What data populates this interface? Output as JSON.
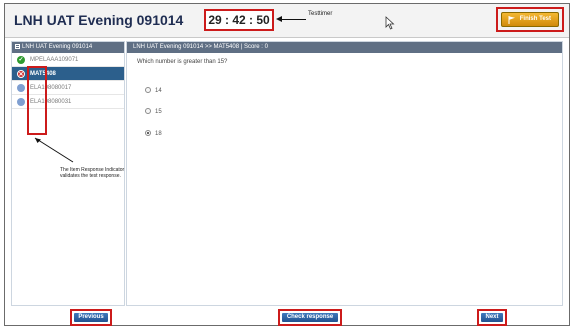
{
  "header": {
    "title": "LNH UAT Evening 091014",
    "timer": "29 : 42 : 50",
    "timer_callout": "Testtimer",
    "finish_label": "Finish Test"
  },
  "left_panel": {
    "title": "LNH UAT Evening 091014",
    "items": [
      {
        "label": "MPELAAA109071",
        "status": "correct"
      },
      {
        "label": "MAT5408",
        "status": "wrong",
        "active": true
      },
      {
        "label": "ELA108080017",
        "status": "unanswered"
      },
      {
        "label": "ELA108080031",
        "status": "unanswered"
      }
    ],
    "note": "The Item Response Indicator validates the test response."
  },
  "question": {
    "breadcrumb": "LNH UAT Evening 091014 >> MAT5408  |  Score : 0",
    "prompt": "Which number is greater than 15?",
    "options": [
      {
        "label": "14",
        "selected": false
      },
      {
        "label": "15",
        "selected": false
      },
      {
        "label": "18",
        "selected": true
      }
    ]
  },
  "footer": {
    "previous_label": "Previous",
    "check_label": "Check response",
    "next_label": "Next"
  },
  "colors": {
    "title": "#1f2d52",
    "highlight": "#cc1b1b",
    "panel_header": "#5f6f84",
    "active_item": "#2c5f8c",
    "button": "#2f64a6",
    "finish_button": "#e3a11d"
  }
}
